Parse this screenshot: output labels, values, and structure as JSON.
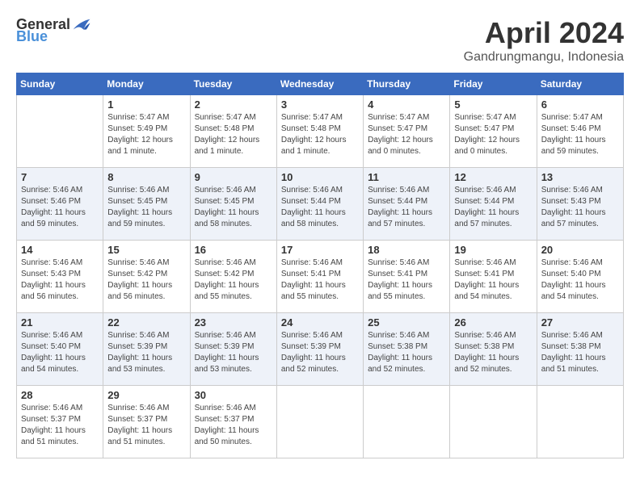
{
  "header": {
    "logo_general": "General",
    "logo_blue": "Blue",
    "month_year": "April 2024",
    "location": "Gandrungmangu, Indonesia"
  },
  "days_of_week": [
    "Sunday",
    "Monday",
    "Tuesday",
    "Wednesday",
    "Thursday",
    "Friday",
    "Saturday"
  ],
  "weeks": [
    [
      {
        "date": "",
        "info": ""
      },
      {
        "date": "1",
        "info": "Sunrise: 5:47 AM\nSunset: 5:49 PM\nDaylight: 12 hours\nand 1 minute."
      },
      {
        "date": "2",
        "info": "Sunrise: 5:47 AM\nSunset: 5:48 PM\nDaylight: 12 hours\nand 1 minute."
      },
      {
        "date": "3",
        "info": "Sunrise: 5:47 AM\nSunset: 5:48 PM\nDaylight: 12 hours\nand 1 minute."
      },
      {
        "date": "4",
        "info": "Sunrise: 5:47 AM\nSunset: 5:47 PM\nDaylight: 12 hours\nand 0 minutes."
      },
      {
        "date": "5",
        "info": "Sunrise: 5:47 AM\nSunset: 5:47 PM\nDaylight: 12 hours\nand 0 minutes."
      },
      {
        "date": "6",
        "info": "Sunrise: 5:47 AM\nSunset: 5:46 PM\nDaylight: 11 hours\nand 59 minutes."
      }
    ],
    [
      {
        "date": "7",
        "info": "Sunrise: 5:46 AM\nSunset: 5:46 PM\nDaylight: 11 hours\nand 59 minutes."
      },
      {
        "date": "8",
        "info": "Sunrise: 5:46 AM\nSunset: 5:45 PM\nDaylight: 11 hours\nand 59 minutes."
      },
      {
        "date": "9",
        "info": "Sunrise: 5:46 AM\nSunset: 5:45 PM\nDaylight: 11 hours\nand 58 minutes."
      },
      {
        "date": "10",
        "info": "Sunrise: 5:46 AM\nSunset: 5:44 PM\nDaylight: 11 hours\nand 58 minutes."
      },
      {
        "date": "11",
        "info": "Sunrise: 5:46 AM\nSunset: 5:44 PM\nDaylight: 11 hours\nand 57 minutes."
      },
      {
        "date": "12",
        "info": "Sunrise: 5:46 AM\nSunset: 5:44 PM\nDaylight: 11 hours\nand 57 minutes."
      },
      {
        "date": "13",
        "info": "Sunrise: 5:46 AM\nSunset: 5:43 PM\nDaylight: 11 hours\nand 57 minutes."
      }
    ],
    [
      {
        "date": "14",
        "info": "Sunrise: 5:46 AM\nSunset: 5:43 PM\nDaylight: 11 hours\nand 56 minutes."
      },
      {
        "date": "15",
        "info": "Sunrise: 5:46 AM\nSunset: 5:42 PM\nDaylight: 11 hours\nand 56 minutes."
      },
      {
        "date": "16",
        "info": "Sunrise: 5:46 AM\nSunset: 5:42 PM\nDaylight: 11 hours\nand 55 minutes."
      },
      {
        "date": "17",
        "info": "Sunrise: 5:46 AM\nSunset: 5:41 PM\nDaylight: 11 hours\nand 55 minutes."
      },
      {
        "date": "18",
        "info": "Sunrise: 5:46 AM\nSunset: 5:41 PM\nDaylight: 11 hours\nand 55 minutes."
      },
      {
        "date": "19",
        "info": "Sunrise: 5:46 AM\nSunset: 5:41 PM\nDaylight: 11 hours\nand 54 minutes."
      },
      {
        "date": "20",
        "info": "Sunrise: 5:46 AM\nSunset: 5:40 PM\nDaylight: 11 hours\nand 54 minutes."
      }
    ],
    [
      {
        "date": "21",
        "info": "Sunrise: 5:46 AM\nSunset: 5:40 PM\nDaylight: 11 hours\nand 54 minutes."
      },
      {
        "date": "22",
        "info": "Sunrise: 5:46 AM\nSunset: 5:39 PM\nDaylight: 11 hours\nand 53 minutes."
      },
      {
        "date": "23",
        "info": "Sunrise: 5:46 AM\nSunset: 5:39 PM\nDaylight: 11 hours\nand 53 minutes."
      },
      {
        "date": "24",
        "info": "Sunrise: 5:46 AM\nSunset: 5:39 PM\nDaylight: 11 hours\nand 52 minutes."
      },
      {
        "date": "25",
        "info": "Sunrise: 5:46 AM\nSunset: 5:38 PM\nDaylight: 11 hours\nand 52 minutes."
      },
      {
        "date": "26",
        "info": "Sunrise: 5:46 AM\nSunset: 5:38 PM\nDaylight: 11 hours\nand 52 minutes."
      },
      {
        "date": "27",
        "info": "Sunrise: 5:46 AM\nSunset: 5:38 PM\nDaylight: 11 hours\nand 51 minutes."
      }
    ],
    [
      {
        "date": "28",
        "info": "Sunrise: 5:46 AM\nSunset: 5:37 PM\nDaylight: 11 hours\nand 51 minutes."
      },
      {
        "date": "29",
        "info": "Sunrise: 5:46 AM\nSunset: 5:37 PM\nDaylight: 11 hours\nand 51 minutes."
      },
      {
        "date": "30",
        "info": "Sunrise: 5:46 AM\nSunset: 5:37 PM\nDaylight: 11 hours\nand 50 minutes."
      },
      {
        "date": "",
        "info": ""
      },
      {
        "date": "",
        "info": ""
      },
      {
        "date": "",
        "info": ""
      },
      {
        "date": "",
        "info": ""
      }
    ]
  ]
}
